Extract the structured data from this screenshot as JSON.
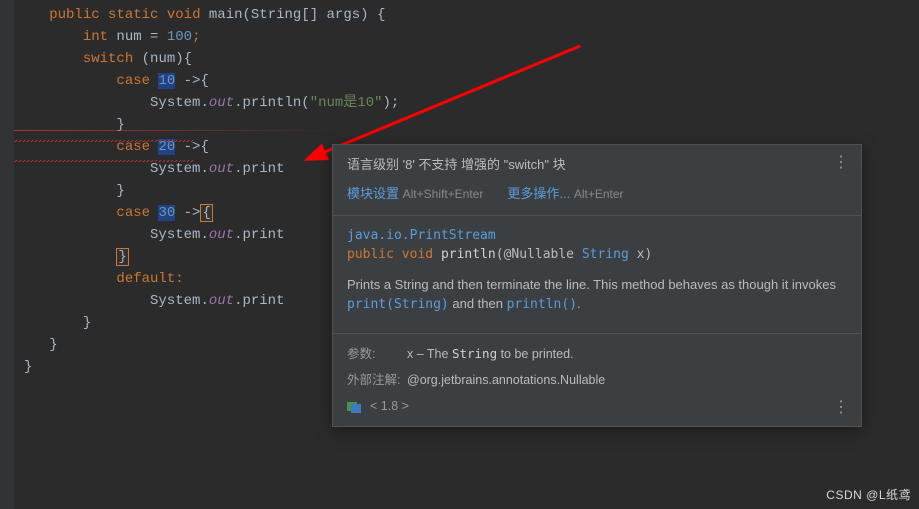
{
  "code": {
    "l1_public": "public",
    "l1_static": "static",
    "l1_void": "void",
    "l1_main": " main(",
    "l1_string": "String",
    "l1_post": "[] args) {",
    "l2_int": "int",
    "l2_var": " num = ",
    "l2_val": "100",
    "l2_semi": ";",
    "l3_switch": "switch",
    "l3_post": " (num){",
    "l4_case": "case",
    "l4_num": "10",
    "l4_arrow": " ->{",
    "l5_pre": "System.",
    "l5_out": "out",
    "l5_call": ".println(",
    "l5_str": "\"num是10\"",
    "l5_post": ");",
    "l6": "}",
    "l7_case": "case",
    "l7_num": "20",
    "l7_arrow": " ->{",
    "l8_pre": "System.",
    "l8_out": "out",
    "l8_call": ".print",
    "l9": "}",
    "l10_case": "case",
    "l10_num": "30",
    "l10_arrow": " ->",
    "l10_brace": "{",
    "l11_pre": "System.",
    "l11_out": "out",
    "l11_call": ".print",
    "l12_brace": "}",
    "l13_default": "default",
    "l13_colon": ":",
    "l14_pre": "System.",
    "l14_out": "out",
    "l14_call": ".print",
    "l15": "}",
    "l16": "}",
    "l17": "}"
  },
  "popup": {
    "title": "语言级别 '8' 不支持 增强的 \"switch\" 块",
    "action1_label": "模块设置",
    "action1_shortcut": "Alt+Shift+Enter",
    "action2_label": "更多操作...",
    "action2_shortcut": "Alt+Enter",
    "sig_class": "java.io.PrintStream",
    "sig_public": "public",
    "sig_void": "void",
    "sig_method": "println",
    "sig_open": "(",
    "sig_ann": "@Nullable",
    "sig_type": "String",
    "sig_param": " x)",
    "desc_t1": "Prints a String and then terminate the line. This method behaves as though it invokes ",
    "desc_link1": "print(String)",
    "desc_t2": " and then ",
    "desc_link2": "println()",
    "desc_t3": ".",
    "params_label": "参数:",
    "params_pre": "x – The ",
    "params_code": "String",
    "params_post": " to be printed.",
    "ext_label": "外部注解:",
    "ext_val": "@org.jetbrains.annotations.Nullable",
    "lang_level": "< 1.8 >",
    "dots": "⋮"
  },
  "watermark": "CSDN @L纸鸢"
}
